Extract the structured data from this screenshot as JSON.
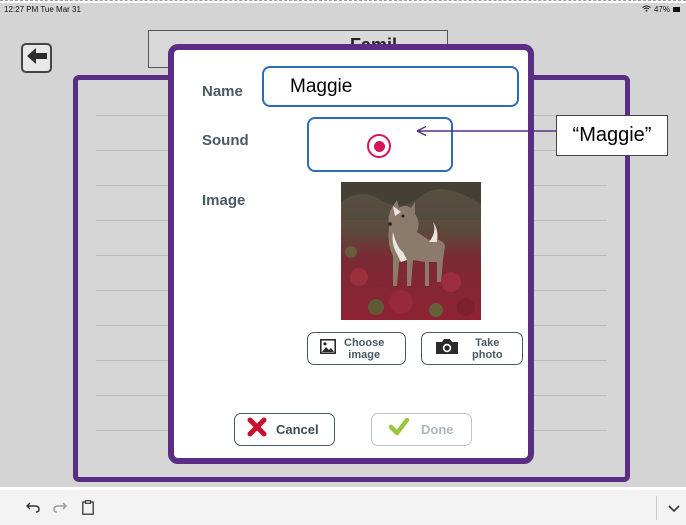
{
  "status_bar": {
    "time": "12:27 PM  Tue Mar 31",
    "battery": "47%"
  },
  "header": {
    "title_partial": "Famil"
  },
  "dialog": {
    "name_label": "Name",
    "name_value": "Maggie",
    "sound_label": "Sound",
    "image_label": "Image",
    "choose_image_label_1": "Choose",
    "choose_image_label_2": "image",
    "take_photo_label_1": "Take",
    "take_photo_label_2": "photo",
    "cancel_label": "Cancel",
    "done_label": "Done"
  },
  "callout": {
    "text": "“Maggie”"
  },
  "icons": {
    "back": "arrow-left-icon",
    "record": "record-icon",
    "choose_image": "image-icon",
    "take_photo": "camera-icon",
    "cancel": "x-icon",
    "done": "check-icon",
    "undo": "undo-icon",
    "redo": "redo-icon",
    "clipboard": "clipboard-icon",
    "collapse": "chevron-down-icon"
  },
  "colors": {
    "frame": "#5b2d85",
    "focus": "#2a6db5",
    "record": "#d4145a",
    "cancel_x": "#c8102e",
    "done_check": "#9bc53d"
  }
}
